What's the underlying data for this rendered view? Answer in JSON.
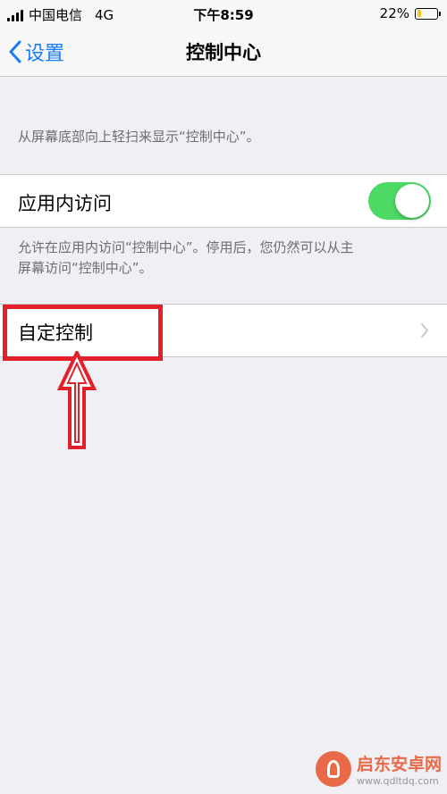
{
  "status_bar": {
    "carrier": "中国电信",
    "network": "4G",
    "time": "下午8:59",
    "battery_percent": "22%",
    "battery_level": 0.22
  },
  "nav": {
    "back_label": "设置",
    "title": "控制中心"
  },
  "content": {
    "intro_text": "从屏幕底部向上轻扫来显示“控制中心”。",
    "access_in_apps": {
      "label": "应用内访问",
      "enabled": true
    },
    "access_note_line1": "允许在应用内访问“控制中心”。停用后，您仍然可以从主",
    "access_note_line2": "屏幕访问“控制中心”。",
    "customize_label": "自定控制"
  },
  "watermark": {
    "name": "启东安卓网",
    "url": "www.qdltdq.com"
  },
  "colors": {
    "accent": "#1a7cf5",
    "toggle_on": "#4cd964",
    "highlight": "#e32029",
    "background": "#efeff4"
  }
}
